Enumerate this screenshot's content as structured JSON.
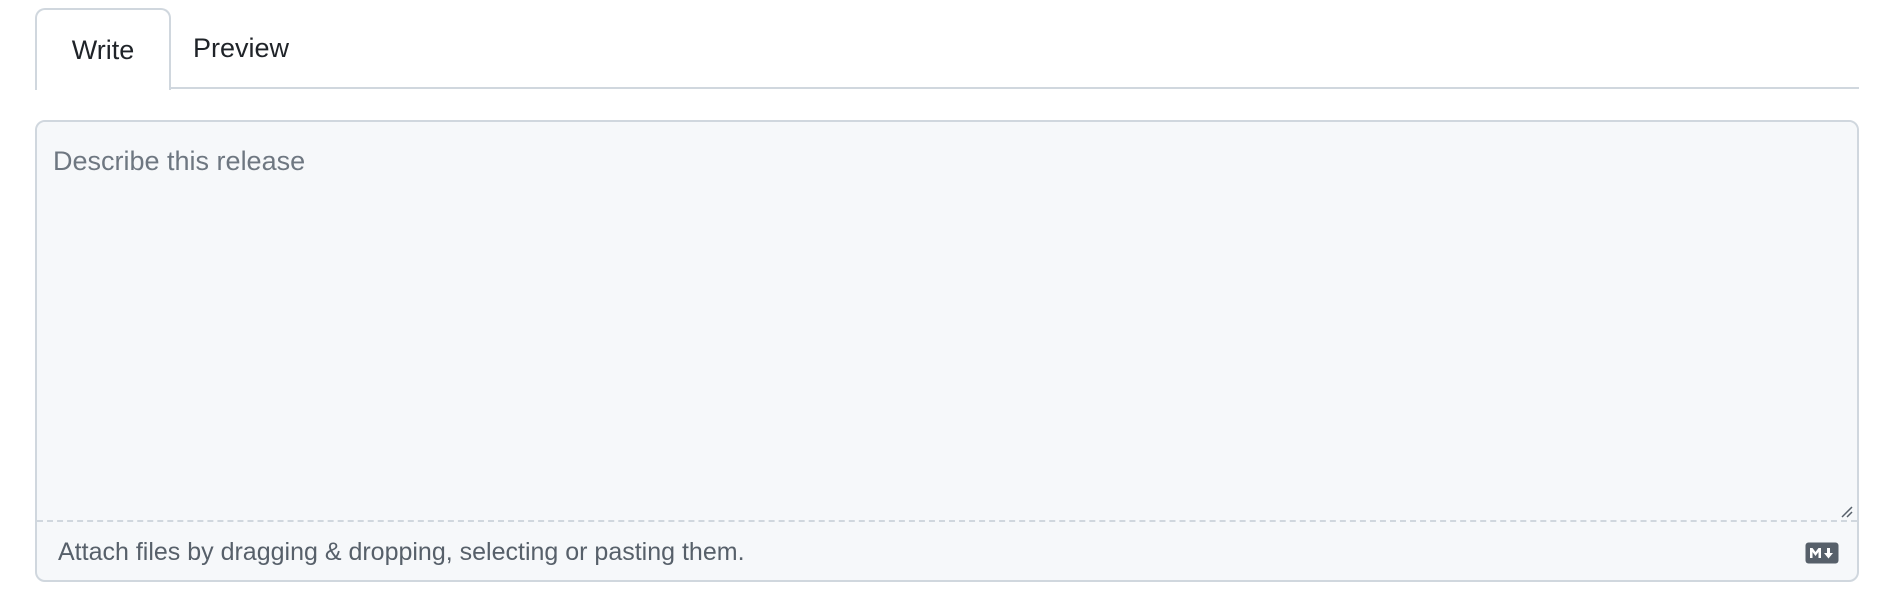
{
  "tabs": [
    {
      "label": "Write",
      "selected": true
    },
    {
      "label": "Preview",
      "selected": false
    }
  ],
  "editor": {
    "placeholder": "Describe this release",
    "value": ""
  },
  "footer": {
    "attach_text": "Attach files by dragging & dropping, selecting or pasting them.",
    "markdown_icon": "markdown-icon"
  },
  "colors": {
    "border": "#d0d7de",
    "editor_bg": "#f6f8fa",
    "text": "#1f2328",
    "muted_text": "#57606a",
    "placeholder": "#6e7781"
  }
}
